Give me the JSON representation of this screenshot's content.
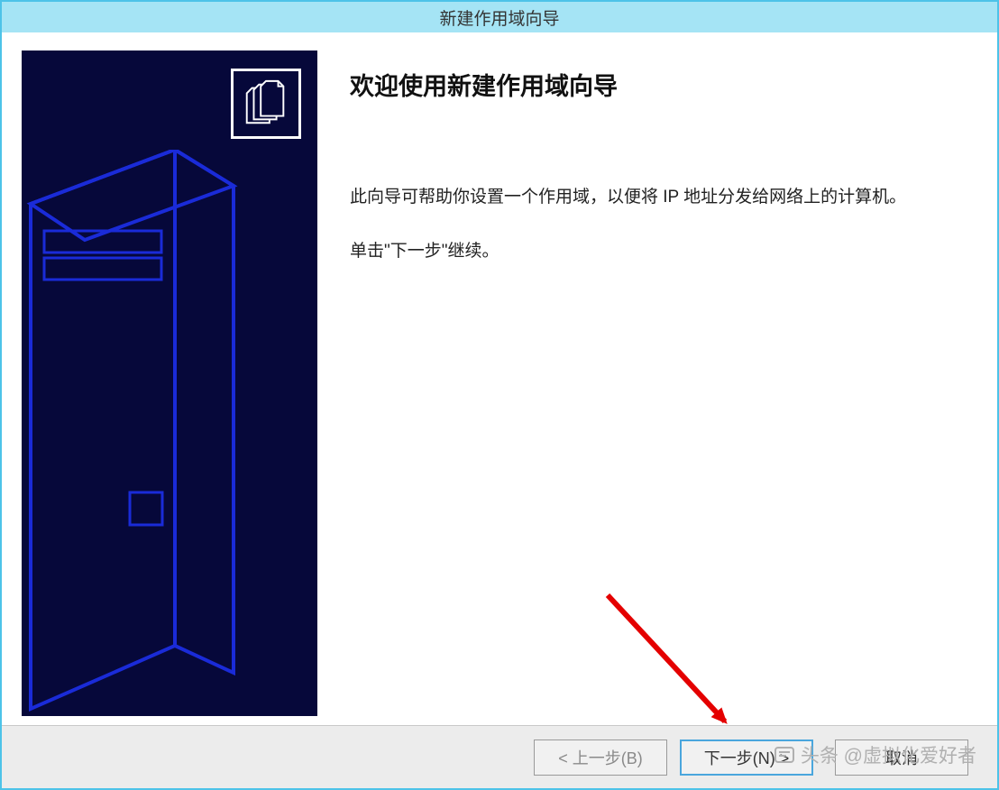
{
  "window": {
    "title": "新建作用域向导"
  },
  "content": {
    "heading": "欢迎使用新建作用域向导",
    "description1": "此向导可帮助你设置一个作用域，以便将 IP 地址分发给网络上的计算机。",
    "description2": "单击\"下一步\"继续。"
  },
  "buttons": {
    "back": "< 上一步(B)",
    "next": "下一步(N) >",
    "cancel": "取消"
  },
  "watermark": {
    "text": "头条 @虚拟化爱好者"
  }
}
